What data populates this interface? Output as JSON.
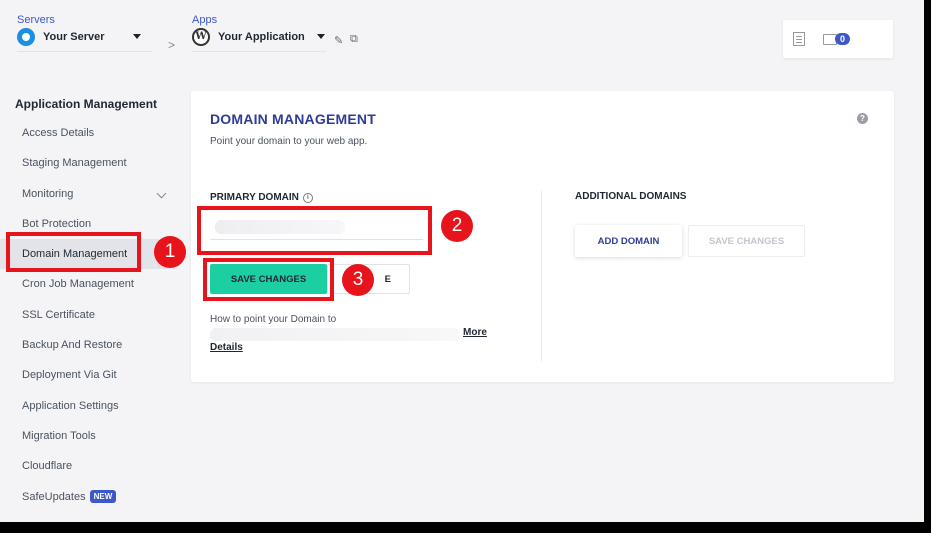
{
  "header": {
    "servers_label": "Servers",
    "server_name": "Your Server",
    "apps_label": "Apps",
    "app_name": "Your Application",
    "separator": ">",
    "edit_icon": "✎",
    "external_icon": "⧉",
    "notification_count": "0"
  },
  "sidebar": {
    "title": "Application Management",
    "items": [
      {
        "label": "Access Details"
      },
      {
        "label": "Staging Management"
      },
      {
        "label": "Monitoring"
      },
      {
        "label": "Bot Protection"
      },
      {
        "label": "Domain Management"
      },
      {
        "label": "Cron Job Management"
      },
      {
        "label": "SSL Certificate"
      },
      {
        "label": "Backup And Restore"
      },
      {
        "label": "Deployment Via Git"
      },
      {
        "label": "Application Settings"
      },
      {
        "label": "Migration Tools"
      },
      {
        "label": "Cloudflare"
      },
      {
        "label": "SafeUpdates",
        "badge": "NEW"
      }
    ]
  },
  "main": {
    "title": "DOMAIN MANAGEMENT",
    "subtitle": "Point your domain to your web app.",
    "help_icon": "?",
    "primary_domain_label": "PRIMARY DOMAIN",
    "info_icon": "i",
    "primary_domain_value": "",
    "save_button": "SAVE CHANGES",
    "second_button_partial": "E",
    "howto_text": "How to point your Domain to",
    "more_link": "More",
    "details_link": "Details",
    "additional_label": "ADDITIONAL DOMAINS",
    "add_domain_button": "ADD DOMAIN",
    "save_changes_disabled": "SAVE CHANGES"
  },
  "annotations": {
    "marker_1": "1",
    "marker_2": "2",
    "marker_3": "3",
    "color": "#e8141c"
  },
  "colors": {
    "accent": "#3d58c8",
    "title": "#2c3e99",
    "save_button": "#1ccfa3"
  }
}
